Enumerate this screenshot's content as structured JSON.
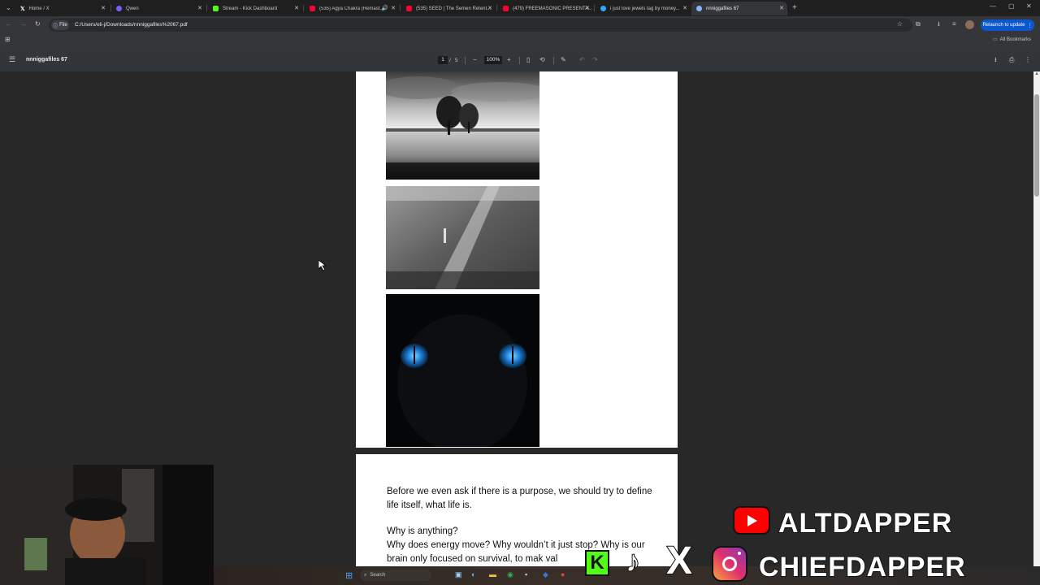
{
  "tabs": [
    {
      "title": "Home / X",
      "icon": "x-logo-icon",
      "color": "#ffffff"
    },
    {
      "title": "Qwen",
      "icon": "qwen-icon",
      "color": "#7c5cff"
    },
    {
      "title": "Stream - Kick Dashboard",
      "icon": "kick-icon",
      "color": "#53fc18"
    },
    {
      "title": "(535) Agya Chakra (Remast...",
      "icon": "youtube-icon",
      "color": "#ff0033"
    },
    {
      "title": "(535) SEED | The Semen Retent...",
      "icon": "youtube-icon",
      "color": "#ff0033"
    },
    {
      "title": "(479) FREEMASONIC PRESENTA...",
      "icon": "youtube-icon",
      "color": "#ff0033"
    },
    {
      "title": "i just love jewels tag by money...",
      "icon": "globe-icon",
      "color": "#2ea8ff"
    },
    {
      "title": "nnniggafiles 67",
      "icon": "globe-icon",
      "color": "#8ab4f8"
    }
  ],
  "address": {
    "scheme": "File",
    "url": "C:/Users/eli-j/Downloads/nnniggafiles%2067.pdf"
  },
  "relaunch_label": "Relaunch to update",
  "bookmarks_label": "All Bookmarks",
  "pdf": {
    "title": "nnniggafiles 67",
    "page_current": "1",
    "page_total": "5",
    "zoom": "100%"
  },
  "text_block": {
    "para1": "Before we even ask if there is a purpose, we should try to define life itself, what life is.",
    "para2": "Why is anything?",
    "para3": "Why does energy move? Why wouldn’t it just  stop? Why is our brain only focused on survival, to mak     val"
  },
  "overlay": {
    "channel1": "ALTDAPPER",
    "channel2": "CHIEFDAPPER"
  },
  "taskbar": {
    "search_placeholder": "Search"
  },
  "colors": {
    "youtube": "#ff0000",
    "kick": "#53fc18",
    "instagram": "#e1306c",
    "accent": "#8ab4f8"
  }
}
